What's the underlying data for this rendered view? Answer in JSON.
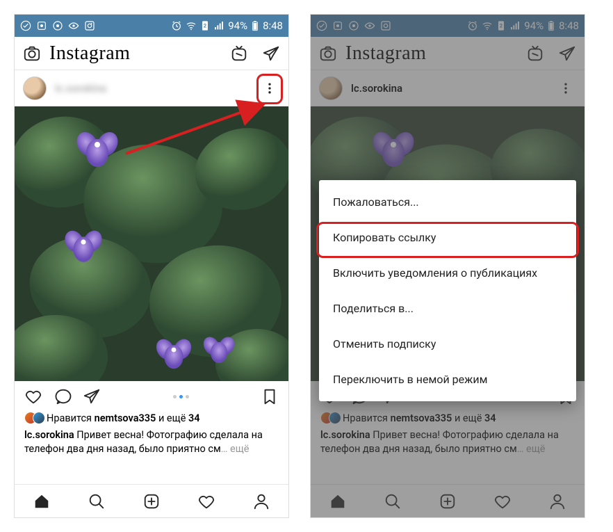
{
  "status": {
    "battery_text": "94%",
    "time": "8:48"
  },
  "app": {
    "logo": "Instagram"
  },
  "post": {
    "username_left": "lc.sorokina",
    "username_right": "lc.sorokina",
    "liked_by_name": "nemtsova335",
    "liked_by_count": "34",
    "likes_prefix": "Нравится",
    "likes_join": "и ещё",
    "caption_author": "lc.sorokina",
    "caption_text": "Привет весна! Фотографию сделала на телефон два дня назад, было приятно см",
    "caption_more": "… ещё"
  },
  "menu": {
    "items": [
      "Пожаловаться...",
      "Копировать ссылку",
      "Включить уведомления о публикациях",
      "Поделиться в...",
      "Отменить подписку",
      "Переключить в немой режим"
    ]
  }
}
